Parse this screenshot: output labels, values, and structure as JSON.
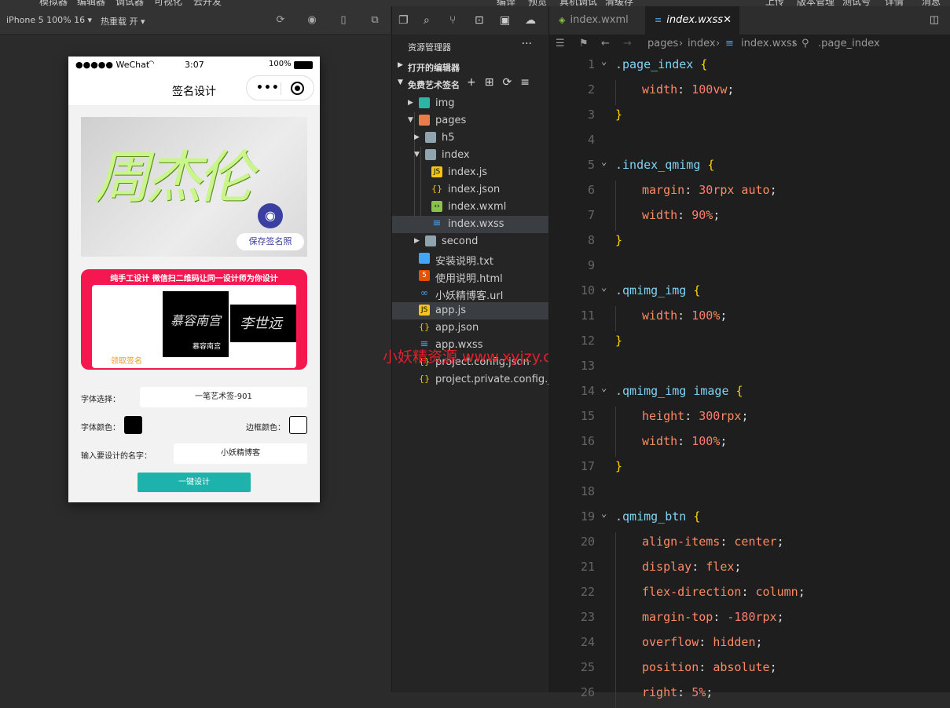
{
  "top_menu": [
    "模拟器",
    "编辑器",
    "调试器",
    "可视化",
    "云开发",
    "编译",
    "预览",
    "真机调试",
    "清缓存",
    "上传",
    "版本管理",
    "测试号",
    "详情",
    "消息"
  ],
  "simulator": {
    "device": "iPhone 5 100% 16 ▾",
    "hot_reload": "热重载 开 ▾",
    "status": {
      "carrier": "●●●●● WeChat",
      "time": "3:07",
      "battery": "100%"
    },
    "nav_title": "签名设计",
    "banner": {
      "save_label": "保存签名照",
      "sig_text": "周杰伦"
    },
    "ad": {
      "title": "纯手工设计 微信扫二维码让同一设计师为你设计",
      "claim": "领取签名",
      "img1_caption": "慕容南宫",
      "img1_text": "慕容南宫",
      "img2_text": "李世远"
    },
    "form": {
      "font_label": "字体选择：",
      "font_value": "一笔艺术签-901",
      "color_label": "字体颜色：",
      "border_label": "边框颜色：",
      "name_label": "输入要设计的名字：",
      "name_value": "小妖精博客",
      "submit": "一键设计",
      "font_color": "#000000",
      "border_color": "#ffffff"
    }
  },
  "explorer": {
    "title": "资源管理器",
    "open_editors": "打开的编辑器",
    "project": "免费艺术签名",
    "items": [
      {
        "name": "img"
      },
      {
        "name": "pages"
      },
      {
        "name": "h5"
      },
      {
        "name": "index"
      },
      {
        "name": "index.js"
      },
      {
        "name": "index.json"
      },
      {
        "name": "index.wxml"
      },
      {
        "name": "index.wxss"
      },
      {
        "name": "second"
      },
      {
        "name": "安装说明.txt"
      },
      {
        "name": "使用说明.html"
      },
      {
        "name": "小妖精博客.url"
      },
      {
        "name": "app.js"
      },
      {
        "name": "app.json"
      },
      {
        "name": "app.wxss"
      },
      {
        "name": "project.config.json"
      },
      {
        "name": "project.private.config.js..."
      }
    ]
  },
  "watermark": "小妖精资源 www.xyjzy.com",
  "editor": {
    "tabs": [
      {
        "name": "index.wxml"
      },
      {
        "name": "index.wxss"
      }
    ],
    "breadcrumb": {
      "p1": "pages",
      "p2": "index",
      "p3": "index.wxss",
      "p4": ".page_index"
    },
    "lines": [
      {
        "n": "1",
        "t": "sel",
        "s": ".page_index",
        "fold": true
      },
      {
        "n": "2",
        "t": "decl",
        "p": "width",
        "v": "100",
        "u": "vw"
      },
      {
        "n": "3",
        "t": "close"
      },
      {
        "n": "4",
        "t": "blank"
      },
      {
        "n": "5",
        "t": "sel",
        "s": ".index_qmimg",
        "fold": true
      },
      {
        "n": "6",
        "t": "decl",
        "p": "margin",
        "v": "30",
        "u": "rpx auto"
      },
      {
        "n": "7",
        "t": "decl",
        "p": "width",
        "v": "90",
        "u": "%"
      },
      {
        "n": "8",
        "t": "close"
      },
      {
        "n": "9",
        "t": "blank"
      },
      {
        "n": "10",
        "t": "sel",
        "s": ".qmimg_img",
        "fold": true
      },
      {
        "n": "11",
        "t": "decl",
        "p": "width",
        "v": "100",
        "u": "%"
      },
      {
        "n": "12",
        "t": "close"
      },
      {
        "n": "13",
        "t": "blank"
      },
      {
        "n": "14",
        "t": "sel",
        "s": ".qmimg_img image",
        "fold": true
      },
      {
        "n": "15",
        "t": "decl",
        "p": "height",
        "v": "300",
        "u": "rpx"
      },
      {
        "n": "16",
        "t": "decl",
        "p": "width",
        "v": "100",
        "u": "%"
      },
      {
        "n": "17",
        "t": "close"
      },
      {
        "n": "18",
        "t": "blank"
      },
      {
        "n": "19",
        "t": "sel",
        "s": ".qmimg_btn",
        "fold": true
      },
      {
        "n": "20",
        "t": "decl",
        "p": "align-items",
        "v": "",
        "u": "center"
      },
      {
        "n": "21",
        "t": "decl",
        "p": "display",
        "v": "",
        "u": "flex"
      },
      {
        "n": "22",
        "t": "decl",
        "p": "flex-direction",
        "v": "",
        "u": "column"
      },
      {
        "n": "23",
        "t": "decl",
        "p": "margin-top",
        "v": "-180",
        "u": "rpx"
      },
      {
        "n": "24",
        "t": "decl",
        "p": "overflow",
        "v": "",
        "u": "hidden"
      },
      {
        "n": "25",
        "t": "decl",
        "p": "position",
        "v": "",
        "u": "absolute"
      },
      {
        "n": "26",
        "t": "decl",
        "p": "right",
        "v": "5",
        "u": "%"
      }
    ]
  }
}
